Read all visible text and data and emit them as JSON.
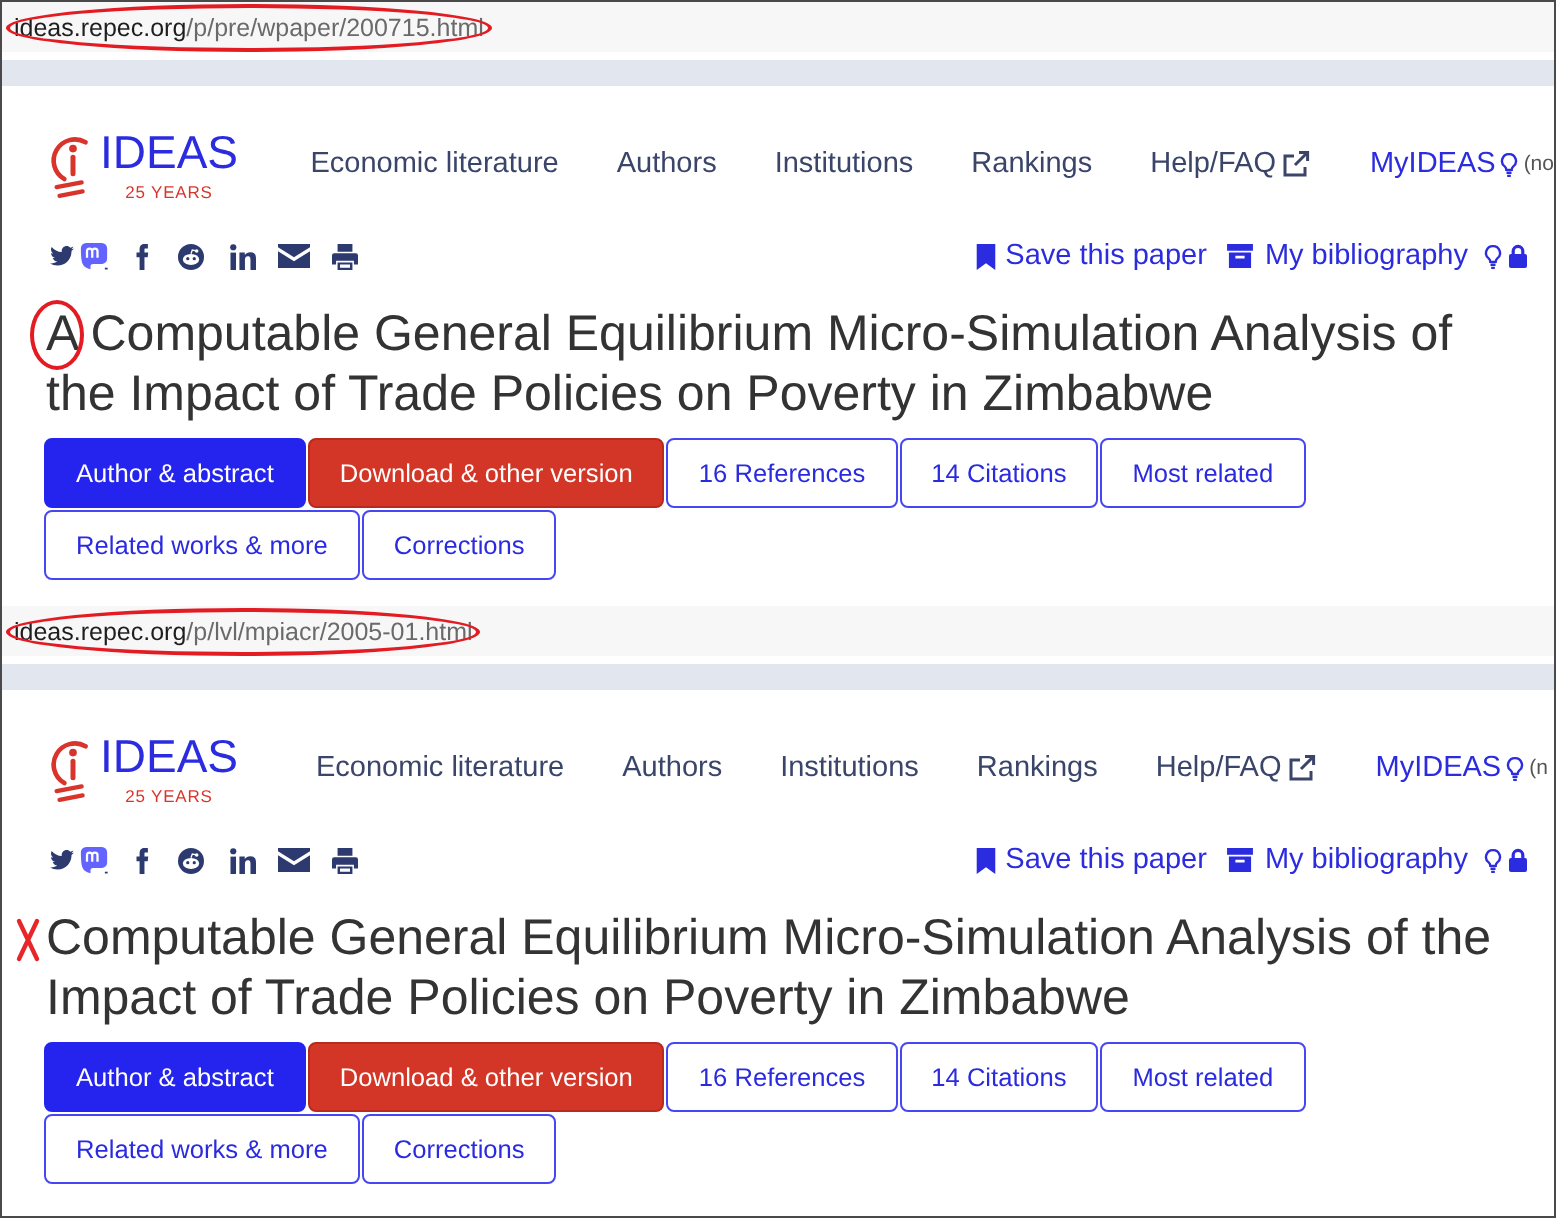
{
  "panels": [
    {
      "address": {
        "host": "ideas.repec.org",
        "path": "/p/pre/wpaper/200715.html",
        "circled": true
      },
      "logo": {
        "wordmark": "IDEAS",
        "tagline": "25 YEARS"
      },
      "nav": [
        {
          "label": "Economic literature",
          "kind": "link"
        },
        {
          "label": "Authors",
          "kind": "link"
        },
        {
          "label": "Institutions",
          "kind": "link"
        },
        {
          "label": "Rankings",
          "kind": "link"
        },
        {
          "label": "Help/FAQ",
          "kind": "external"
        },
        {
          "label": "MyIDEAS",
          "kind": "account",
          "note": "(no"
        }
      ],
      "actions": [
        {
          "label": "Save this paper",
          "kind": "save"
        },
        {
          "label": "My bibliography",
          "kind": "bibliography"
        }
      ],
      "title": {
        "text": "A Computable General Equilibrium Micro-Simulation Analysis of the Impact of Trade Policies on Poverty in Zimbabwe",
        "first_letter_circled": true,
        "cross_mark": false
      },
      "tabs": [
        {
          "label": "Author & abstract",
          "kind": "tab",
          "selected": true
        },
        {
          "label": "Download & other version",
          "kind": "download",
          "selected": false
        },
        {
          "label": "16 References",
          "kind": "tab",
          "selected": false
        },
        {
          "label": "14 Citations",
          "kind": "tab",
          "selected": false
        },
        {
          "label": "Most related",
          "kind": "tab",
          "selected": false
        },
        {
          "label": "Related works & more",
          "kind": "tab",
          "selected": false
        },
        {
          "label": "Corrections",
          "kind": "tab",
          "selected": false
        }
      ]
    },
    {
      "address": {
        "host": "ideas.repec.org",
        "path": "/p/lvl/mpiacr/2005-01.html",
        "circled": true
      },
      "logo": {
        "wordmark": "IDEAS",
        "tagline": "25 YEARS"
      },
      "nav": [
        {
          "label": "Economic literature",
          "kind": "link"
        },
        {
          "label": "Authors",
          "kind": "link"
        },
        {
          "label": "Institutions",
          "kind": "link"
        },
        {
          "label": "Rankings",
          "kind": "link"
        },
        {
          "label": "Help/FAQ",
          "kind": "external"
        },
        {
          "label": "MyIDEAS",
          "kind": "account",
          "note": "(n"
        }
      ],
      "actions": [
        {
          "label": "Save this paper",
          "kind": "save"
        },
        {
          "label": "My bibliography",
          "kind": "bibliography"
        }
      ],
      "title": {
        "text": "Computable General Equilibrium Micro-Simulation Analysis of the Impact of Trade Policies on Poverty in Zimbabwe",
        "first_letter_circled": false,
        "cross_mark": true
      },
      "tabs": [
        {
          "label": "Author & abstract",
          "kind": "tab",
          "selected": true
        },
        {
          "label": "Download & other version",
          "kind": "download",
          "selected": false
        },
        {
          "label": "16 References",
          "kind": "tab",
          "selected": false
        },
        {
          "label": "14 Citations",
          "kind": "tab",
          "selected": false
        },
        {
          "label": "Most related",
          "kind": "tab",
          "selected": false
        },
        {
          "label": "Related works & more",
          "kind": "tab",
          "selected": false
        },
        {
          "label": "Corrections",
          "kind": "tab",
          "selected": false
        }
      ]
    }
  ]
}
